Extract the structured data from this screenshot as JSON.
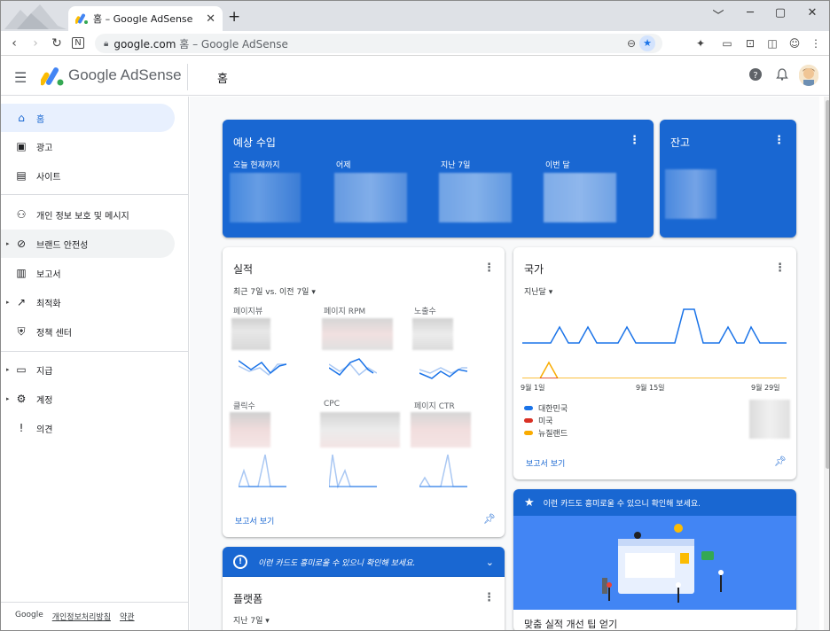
{
  "browser": {
    "tab_title": "홈 – Google AdSense",
    "tab_close": "✕",
    "new_tab": "+",
    "url_host": "google.com",
    "url_rest": " 홈 – Google AdSense",
    "win_minimize": "﹀",
    "win_min": "─",
    "win_max": "▢",
    "win_close": "✕"
  },
  "header": {
    "brand": "Google AdSense",
    "page_title": "홈"
  },
  "sidebar": {
    "items": [
      {
        "label": "홈",
        "icon": "home-icon"
      },
      {
        "label": "광고",
        "icon": "ads-icon"
      },
      {
        "label": "사이트",
        "icon": "sites-icon"
      },
      {
        "label": "개인 정보 보호 및 메시지",
        "icon": "privacy-icon"
      },
      {
        "label": "브랜드 안전성",
        "icon": "block-icon"
      },
      {
        "label": "보고서",
        "icon": "reports-icon"
      },
      {
        "label": "최적화",
        "icon": "trending-icon"
      },
      {
        "label": "정책 센터",
        "icon": "shield-icon"
      },
      {
        "label": "지급",
        "icon": "payments-icon"
      },
      {
        "label": "계정",
        "icon": "gear-icon"
      },
      {
        "label": "의견",
        "icon": "feedback-icon"
      }
    ],
    "footer": {
      "google": "Google",
      "privacy": "개인정보처리방침",
      "terms": "약관"
    }
  },
  "earnings": {
    "title": "예상 수입",
    "cols": [
      "오늘 현재까지",
      "어제",
      "지난 7일",
      "이번 달"
    ]
  },
  "balance": {
    "title": "잔고"
  },
  "performance": {
    "title": "실적",
    "range": "최근 7일 vs. 이전 7일",
    "metrics": [
      "페이지뷰",
      "페이지 RPM",
      "노출수",
      "클릭수",
      "CPC",
      "페이지 CTR"
    ],
    "link": "보고서 보기"
  },
  "countries": {
    "title": "국가",
    "range": "지난달",
    "x_labels": [
      "9월 1일",
      "9월 15일",
      "9월 29일"
    ],
    "legend": [
      {
        "name": "대한민국",
        "color": "#1a73e8"
      },
      {
        "name": "미국",
        "color": "#d93025"
      },
      {
        "name": "뉴질랜드",
        "color": "#f9ab00"
      }
    ],
    "link": "보고서 보기"
  },
  "promo_banner": {
    "text": "이런 카드도 흥미로울 수 있으니 확인해 보세요."
  },
  "promo_card": {
    "text": "이런 카드도 흥미로울 수 있으니 확인해 보세요.",
    "next_title": "맞춤 실적 개선 팁 얻기"
  },
  "platforms": {
    "title": "플랫폼",
    "range": "지난 7일"
  }
}
